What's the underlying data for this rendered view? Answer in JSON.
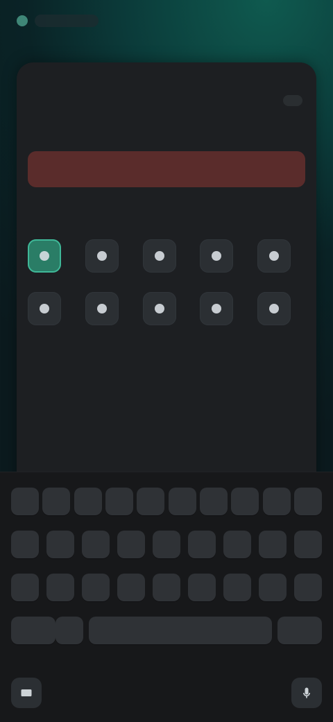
{
  "status": {
    "left_dot_color": "#63c8ae",
    "right_text": ""
  },
  "sheet": {
    "header": {
      "cancel_label": "",
      "title": "",
      "save_label": ""
    },
    "form": {
      "label": "",
      "input_value": "",
      "input_placeholder": "",
      "helper": ""
    },
    "icon_grid": {
      "title": "",
      "icons": [
        {
          "name": "icon-1",
          "selected": true
        },
        {
          "name": "icon-2",
          "selected": false
        },
        {
          "name": "icon-3",
          "selected": false
        },
        {
          "name": "icon-4",
          "selected": false
        },
        {
          "name": "icon-5",
          "selected": false
        },
        {
          "name": "icon-6",
          "selected": false
        },
        {
          "name": "icon-7",
          "selected": false
        },
        {
          "name": "icon-8",
          "selected": false
        },
        {
          "name": "icon-9",
          "selected": false
        },
        {
          "name": "icon-10",
          "selected": false
        }
      ]
    }
  },
  "keyboard": {
    "row1": [
      "",
      "",
      "",
      "",
      "",
      "",
      "",
      "",
      "",
      ""
    ],
    "row2": [
      "",
      "",
      "",
      "",
      "",
      "",
      "",
      "",
      ""
    ],
    "row3": [
      "",
      "",
      "",
      "",
      "",
      "",
      "",
      "",
      ""
    ],
    "bottom": {
      "left_label": "",
      "space_label": "",
      "right_label": ""
    }
  },
  "colors": {
    "accent": "#2a7d66",
    "error": "#5a2c2b",
    "surface": "#1d1f22"
  }
}
